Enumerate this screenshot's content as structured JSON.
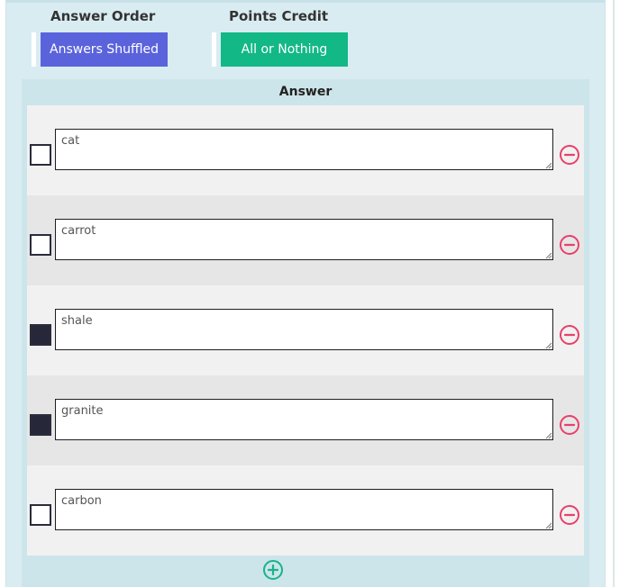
{
  "settings": {
    "answer_order": {
      "label": "Answer Order",
      "value": "Answers Shuffled",
      "color": "#5a63dc"
    },
    "points_credit": {
      "label": "Points Credit",
      "value": "All or Nothing",
      "color": "#12b886"
    }
  },
  "answers_panel": {
    "title": "Answer",
    "items": [
      {
        "text": "cat",
        "correct": false
      },
      {
        "text": "carrot",
        "correct": false
      },
      {
        "text": "shale",
        "correct": true
      },
      {
        "text": "granite",
        "correct": true
      },
      {
        "text": "carbon",
        "correct": false
      }
    ],
    "remove_icon": "minus-circle-icon",
    "add_icon": "plus-circle-icon",
    "remove_color": "#e8416b",
    "add_color": "#1ab38a"
  }
}
